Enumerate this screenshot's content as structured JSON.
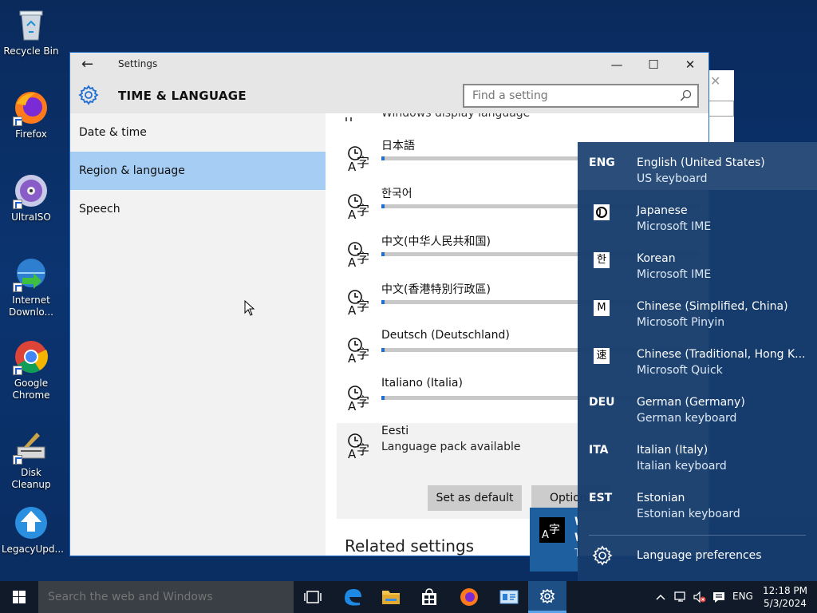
{
  "desktop": {
    "icons": [
      {
        "label": "Recycle Bin"
      },
      {
        "label": "Firefox"
      },
      {
        "label": "UltraISO"
      },
      {
        "label": "Internet Downlo..."
      },
      {
        "label": "Google Chrome"
      },
      {
        "label": "Disk Cleanup"
      },
      {
        "label": "LegacyUpd..."
      }
    ]
  },
  "window": {
    "title": "Settings",
    "section_title": "TIME & LANGUAGE",
    "search_placeholder": "Find a setting",
    "sidebar": {
      "items": [
        {
          "label": "Date & time",
          "active": false
        },
        {
          "label": "Region & language",
          "active": true
        },
        {
          "label": "Speech",
          "active": false
        }
      ]
    },
    "content": {
      "clipped_heading": "Windows display language",
      "languages": [
        {
          "name": "日本語"
        },
        {
          "name": "한국어"
        },
        {
          "name": "中文(中华人民共和国)"
        },
        {
          "name": "中文(香港特別行政區)"
        },
        {
          "name": "Deutsch (Deutschland)"
        },
        {
          "name": "Italiano (Italia)"
        }
      ],
      "selected_language": {
        "name": "Eesti",
        "status": "Language pack available"
      },
      "set_default_label": "Set as default",
      "options_label": "Options",
      "related_settings": "Related settings"
    }
  },
  "notification": {
    "line1": "W",
    "line2": "W",
    "line3": "T"
  },
  "flyout": {
    "items": [
      {
        "code": "ENG",
        "name": "English (United States)",
        "keyboard": "US keyboard",
        "active": true
      },
      {
        "glyph": "J",
        "name": "Japanese",
        "keyboard": "Microsoft IME"
      },
      {
        "glyph": "한",
        "name": "Korean",
        "keyboard": "Microsoft IME"
      },
      {
        "glyph": "M",
        "name": "Chinese (Simplified, China)",
        "keyboard": "Microsoft Pinyin"
      },
      {
        "glyph": "速",
        "name": "Chinese (Traditional, Hong K...",
        "keyboard": "Microsoft Quick"
      },
      {
        "code": "DEU",
        "name": "German (Germany)",
        "keyboard": "German keyboard"
      },
      {
        "code": "ITA",
        "name": "Italian (Italy)",
        "keyboard": "Italian keyboard"
      },
      {
        "code": "EST",
        "name": "Estonian",
        "keyboard": "Estonian keyboard"
      }
    ],
    "preferences_label": "Language preferences"
  },
  "taskbar": {
    "search_placeholder": "Search the web and Windows",
    "tray_lang": "ENG",
    "time": "12:18 PM",
    "date": "5/3/2024"
  },
  "colors": {
    "accent": "#1f6fd1",
    "selected_nav": "#a6cdf3",
    "flyout_bg": "#163c6c",
    "taskbar_bg": "#101a28"
  }
}
